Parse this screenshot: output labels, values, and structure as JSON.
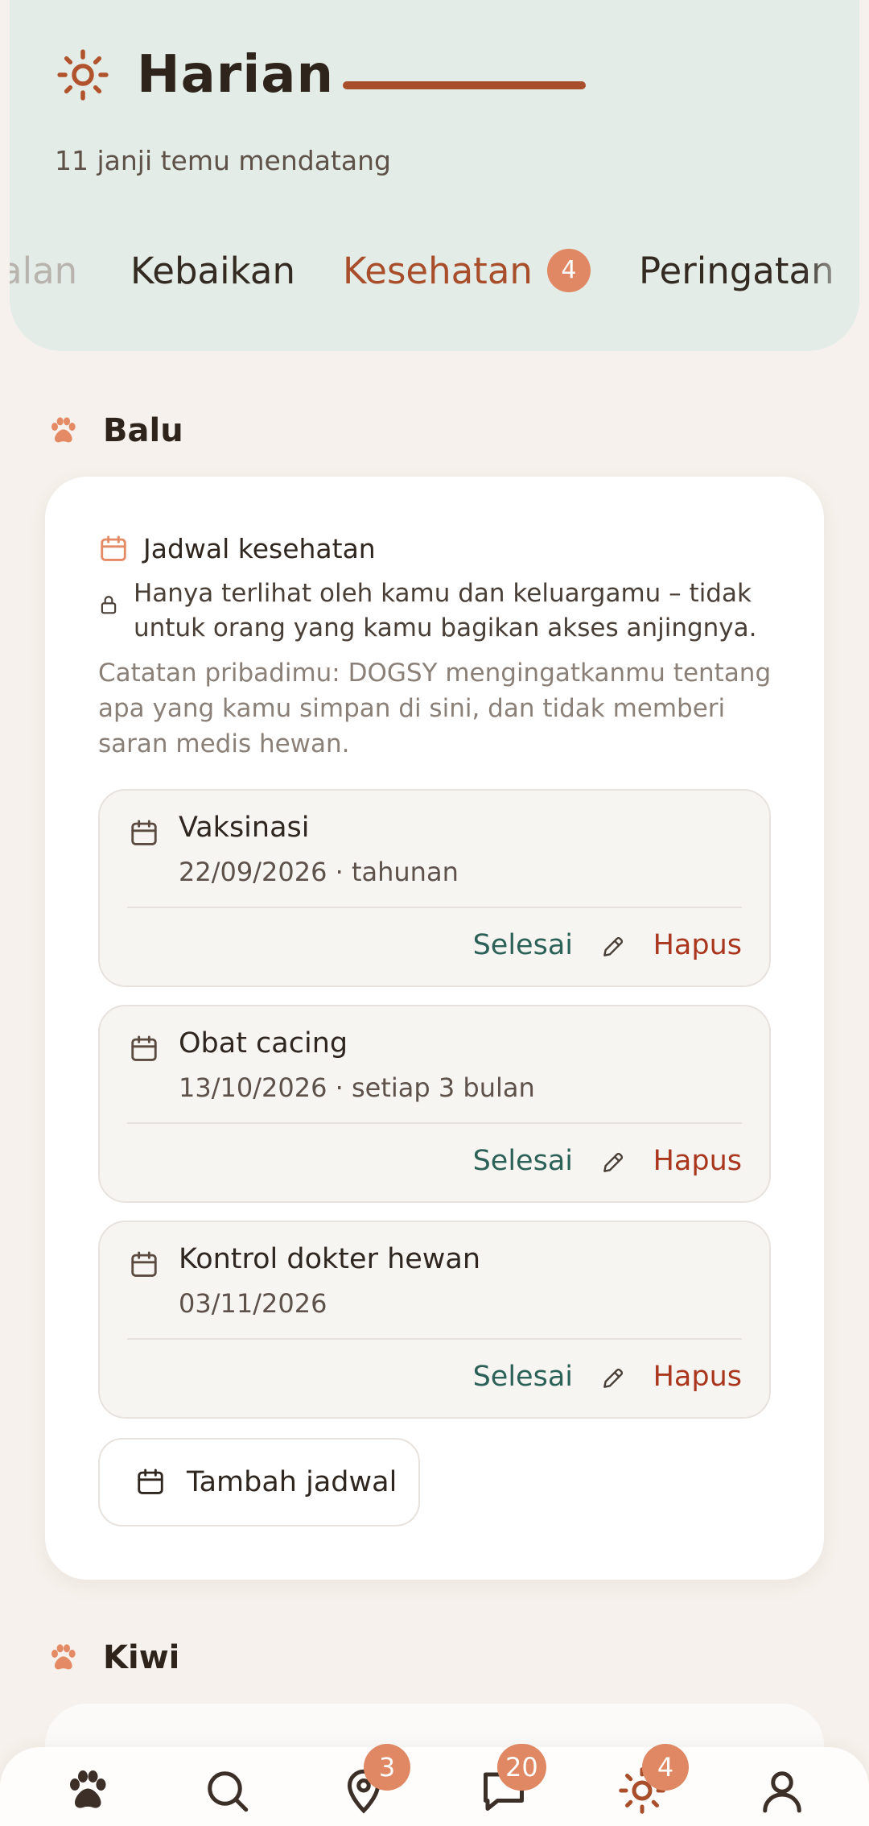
{
  "header": {
    "title": "Harian",
    "subtitle": "11 janji temu mendatang",
    "tabs": [
      {
        "label": "alan"
      },
      {
        "label": "Kebaikan"
      },
      {
        "label": "Kesehatan",
        "badge": "4",
        "active": true
      },
      {
        "label": "Peringatan"
      }
    ]
  },
  "sections": [
    {
      "dog": "Balu",
      "card": {
        "heading": "Jadwal kesehatan",
        "privacy_note": "Hanya terlihat oleh kamu dan keluargamu – tidak untuk orang yang kamu bagikan akses anjingnya.",
        "disclaimer": "Catatan pribadimu: DOGSY mengingatkanmu tentang apa yang kamu simpan di sini, dan tidak memberi saran medis hewan.",
        "items": [
          {
            "name": "Vaksinasi",
            "meta": "22/09/2026 · tahunan",
            "done_label": "Selesai",
            "delete_label": "Hapus"
          },
          {
            "name": "Obat cacing",
            "meta": "13/10/2026 · setiap 3 bulan",
            "done_label": "Selesai",
            "delete_label": "Hapus"
          },
          {
            "name": "Kontrol dokter hewan",
            "meta": "03/11/2026",
            "done_label": "Selesai",
            "delete_label": "Hapus"
          }
        ],
        "add_label": "Tambah jadwal"
      }
    },
    {
      "dog": "Kiwi"
    }
  ],
  "bottom_nav": [
    {
      "icon": "paw-icon"
    },
    {
      "icon": "search-icon"
    },
    {
      "icon": "map-pin-icon",
      "badge": "3"
    },
    {
      "icon": "chat-icon",
      "badge": "20"
    },
    {
      "icon": "sun-icon",
      "badge": "4",
      "active": true
    },
    {
      "icon": "profile-icon"
    }
  ],
  "colors": {
    "accent": "#a84e2b",
    "badge": "#df8863",
    "done": "#2c6157",
    "delete": "#a9361d",
    "header_bg": "#e4ece7"
  }
}
